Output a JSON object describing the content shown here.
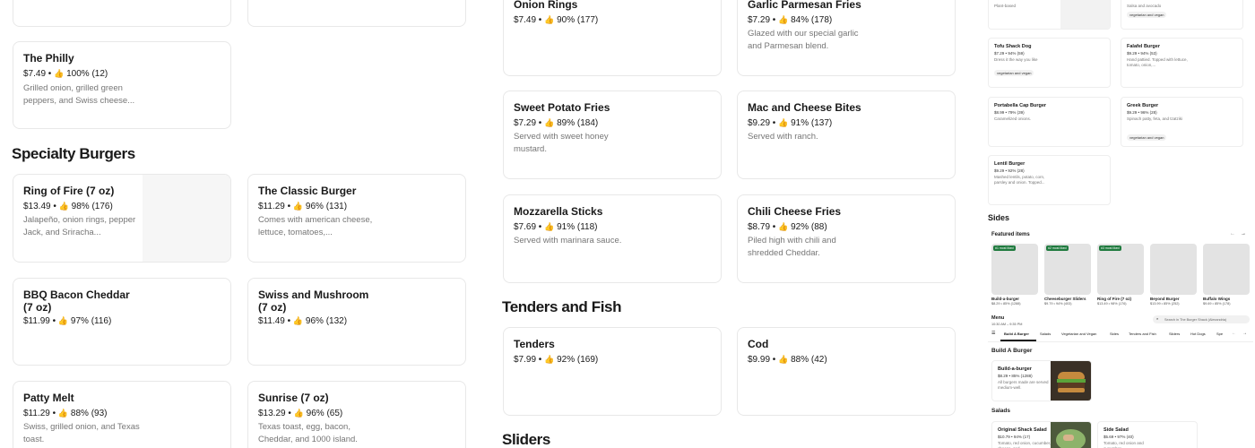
{
  "left_top_cards": [
    {
      "title": "The Philly",
      "meta": "$7.49 • ",
      "rating": "100% (12)",
      "desc": "Grilled onion, grilled green peppers, and Swiss cheese..."
    }
  ],
  "specialty": {
    "heading": "Specialty Burgers",
    "items": [
      {
        "title": "Ring of Fire (7 oz)",
        "meta": "$13.49 • ",
        "rating": "98% (176)",
        "desc": "Jalapeño, onion rings, pepper Jack, and Sriracha..."
      },
      {
        "title": "The Classic Burger",
        "meta": "$11.29 • ",
        "rating": "96% (131)",
        "desc": "Comes with american cheese, lettuce, tomatoes,..."
      },
      {
        "title": "BBQ Bacon Cheddar (7 oz)",
        "meta": "$11.99 • ",
        "rating": "97% (116)",
        "desc": ""
      },
      {
        "title": "Swiss and Mushroom (7 oz)",
        "meta": "$11.49 • ",
        "rating": "96% (132)",
        "desc": ""
      },
      {
        "title": "Patty Melt",
        "meta": "$11.29 • ",
        "rating": "88% (93)",
        "desc": "Swiss, grilled onion, and Texas toast."
      },
      {
        "title": "Sunrise (7 oz)",
        "meta": "$13.29 • ",
        "rating": "96% (65)",
        "desc": "Texas toast, egg, bacon, Cheddar, and 1000 island."
      }
    ]
  },
  "sides": {
    "items": [
      {
        "title": "Onion Rings",
        "meta": "$7.49 • ",
        "rating": "90% (177)",
        "desc": ""
      },
      {
        "title": "Garlic Parmesan Fries",
        "meta": "$7.29 • ",
        "rating": "84% (178)",
        "desc": "Glazed with our special garlic and Parmesan blend."
      },
      {
        "title": "Sweet Potato Fries",
        "meta": "$7.29 • ",
        "rating": "89% (184)",
        "desc": "Served with sweet honey mustard."
      },
      {
        "title": "Mac and Cheese Bites",
        "meta": "$9.29 • ",
        "rating": "91% (137)",
        "desc": "Served with ranch."
      },
      {
        "title": "Mozzarella Sticks",
        "meta": "$7.69 • ",
        "rating": "91% (118)",
        "desc": "Served with marinara sauce."
      },
      {
        "title": "Chili Cheese Fries",
        "meta": "$8.79 • ",
        "rating": "92% (88)",
        "desc": "Piled high with chili and shredded Cheddar."
      }
    ]
  },
  "tenders": {
    "heading": "Tenders and Fish",
    "items": [
      {
        "title": "Tenders",
        "meta": "$7.99 • ",
        "rating": "92% (169)"
      },
      {
        "title": "Cod",
        "meta": "$9.99 • ",
        "rating": "88% (42)"
      }
    ]
  },
  "sliders_heading": "Sliders",
  "like_icon": "thumbs-up-icon",
  "mini": {
    "top_left_desc": "Plant-based",
    "top_right_desc": "Salsa and avocado",
    "top_right_badge": "vegetarian and vegan",
    "cards": [
      {
        "title": "Tofu Shack Dog",
        "meta": "$7.29 • 94% (59)",
        "desc": "Dress it the way you like",
        "badge": "vegetarian and vegan"
      },
      {
        "title": "Falafel Burger",
        "meta": "$9.29 • 94% (53)",
        "desc": "Hand pattied. Topped with lettuce, tomato, onion,...",
        "badge": ""
      },
      {
        "title": "Portabella Cap Burger",
        "meta": "$8.99 • 79% (39)",
        "desc": "Caramelized onions.",
        "badge": ""
      },
      {
        "title": "Greek Burger",
        "meta": "$9.29 • 96% (28)",
        "desc": "Spinach patty, feta, and tzatziki",
        "badge": "vegetarian and vegan"
      },
      {
        "title": "Lentil Burger",
        "meta": "$9.29 • 92% (28)",
        "desc": "Mashed lentils, potato, corn, parsley and onion. Topped...",
        "badge": ""
      }
    ],
    "sides_heading": "Sides",
    "featured_heading": "Featured items",
    "featured": [
      {
        "tag": "#1 most liked",
        "name": "Build-a-burger",
        "meta": "$8.29 • 85% (1288)"
      },
      {
        "tag": "#2 most liked",
        "name": "Cheeseburger Sliders",
        "meta": "$9.79 • 94% (403)"
      },
      {
        "tag": "#3 most liked",
        "name": "Ring of Fire (7 oz)",
        "meta": "$13.49 • 98% (176)"
      },
      {
        "tag": "",
        "name": "Beyond Burger",
        "meta": "$13.99 • 85% (252)"
      },
      {
        "tag": "",
        "name": "Buffalo Wings",
        "meta": "$9.69 • 85% (178)"
      }
    ],
    "menu_label": "Menu",
    "menu_hours": "10:30 AM – 9:35 PM",
    "menu_search_placeholder": "Search in The Burger Shack (Alexandria)",
    "tabs": [
      "Build A Burger",
      "Salads",
      "Vegetarian and Vegan",
      "Sides",
      "Tenders and Fish",
      "Sliders",
      "Hot Dogs",
      "Spe"
    ],
    "build_heading": "Build A Burger",
    "build_item": {
      "title": "Build-a-burger",
      "meta": "$8.29 • 85% (1288)",
      "desc": "All burgers made are served medium-well."
    },
    "salads_heading": "Salads",
    "salads": [
      {
        "title": "Original Shack Salad",
        "meta": "$10.79 • 94% (17)",
        "desc": "Tomato, red onion, cucumber, cheese, and..."
      },
      {
        "title": "Side Salad",
        "meta": "$5.69 • 97% (40)",
        "desc": "Tomato, red onion and cucumber"
      }
    ]
  }
}
